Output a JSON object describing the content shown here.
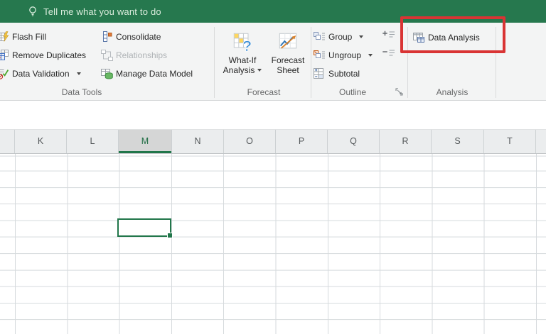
{
  "titlebar": {
    "tell_me_text": "Tell me what you want to do"
  },
  "ribbon": {
    "data_tools": {
      "label": "Data Tools",
      "flash_fill": "Flash Fill",
      "remove_duplicates": "Remove Duplicates",
      "data_validation": "Data Validation",
      "consolidate": "Consolidate",
      "relationships": "Relationships",
      "relationships_enabled": false,
      "manage_data_model": "Manage Data Model"
    },
    "forecast": {
      "label": "Forecast",
      "what_if_analysis_line1": "What-If",
      "what_if_analysis_line2": "Analysis",
      "forecast_sheet_line1": "Forecast",
      "forecast_sheet_line2": "Sheet"
    },
    "outline": {
      "label": "Outline",
      "group": "Group",
      "ungroup": "Ungroup",
      "subtotal": "Subtotal"
    },
    "analysis": {
      "label": "Analysis",
      "data_analysis": "Data Analysis"
    }
  },
  "grid": {
    "column_headers": [
      "K",
      "L",
      "M",
      "N",
      "O",
      "P",
      "Q",
      "R",
      "S",
      "T"
    ],
    "selected_column": "M"
  },
  "highlight": {
    "shape": "red-rectangle",
    "around": "Data Analysis"
  },
  "colors": {
    "excel_green": "#26784e",
    "selection_green": "#21764a",
    "highlight_red": "#d93434",
    "ribbon_bg": "#f3f4f4",
    "gridline": "#d6dadd",
    "selected_header_bg": "#d5d6d6"
  }
}
